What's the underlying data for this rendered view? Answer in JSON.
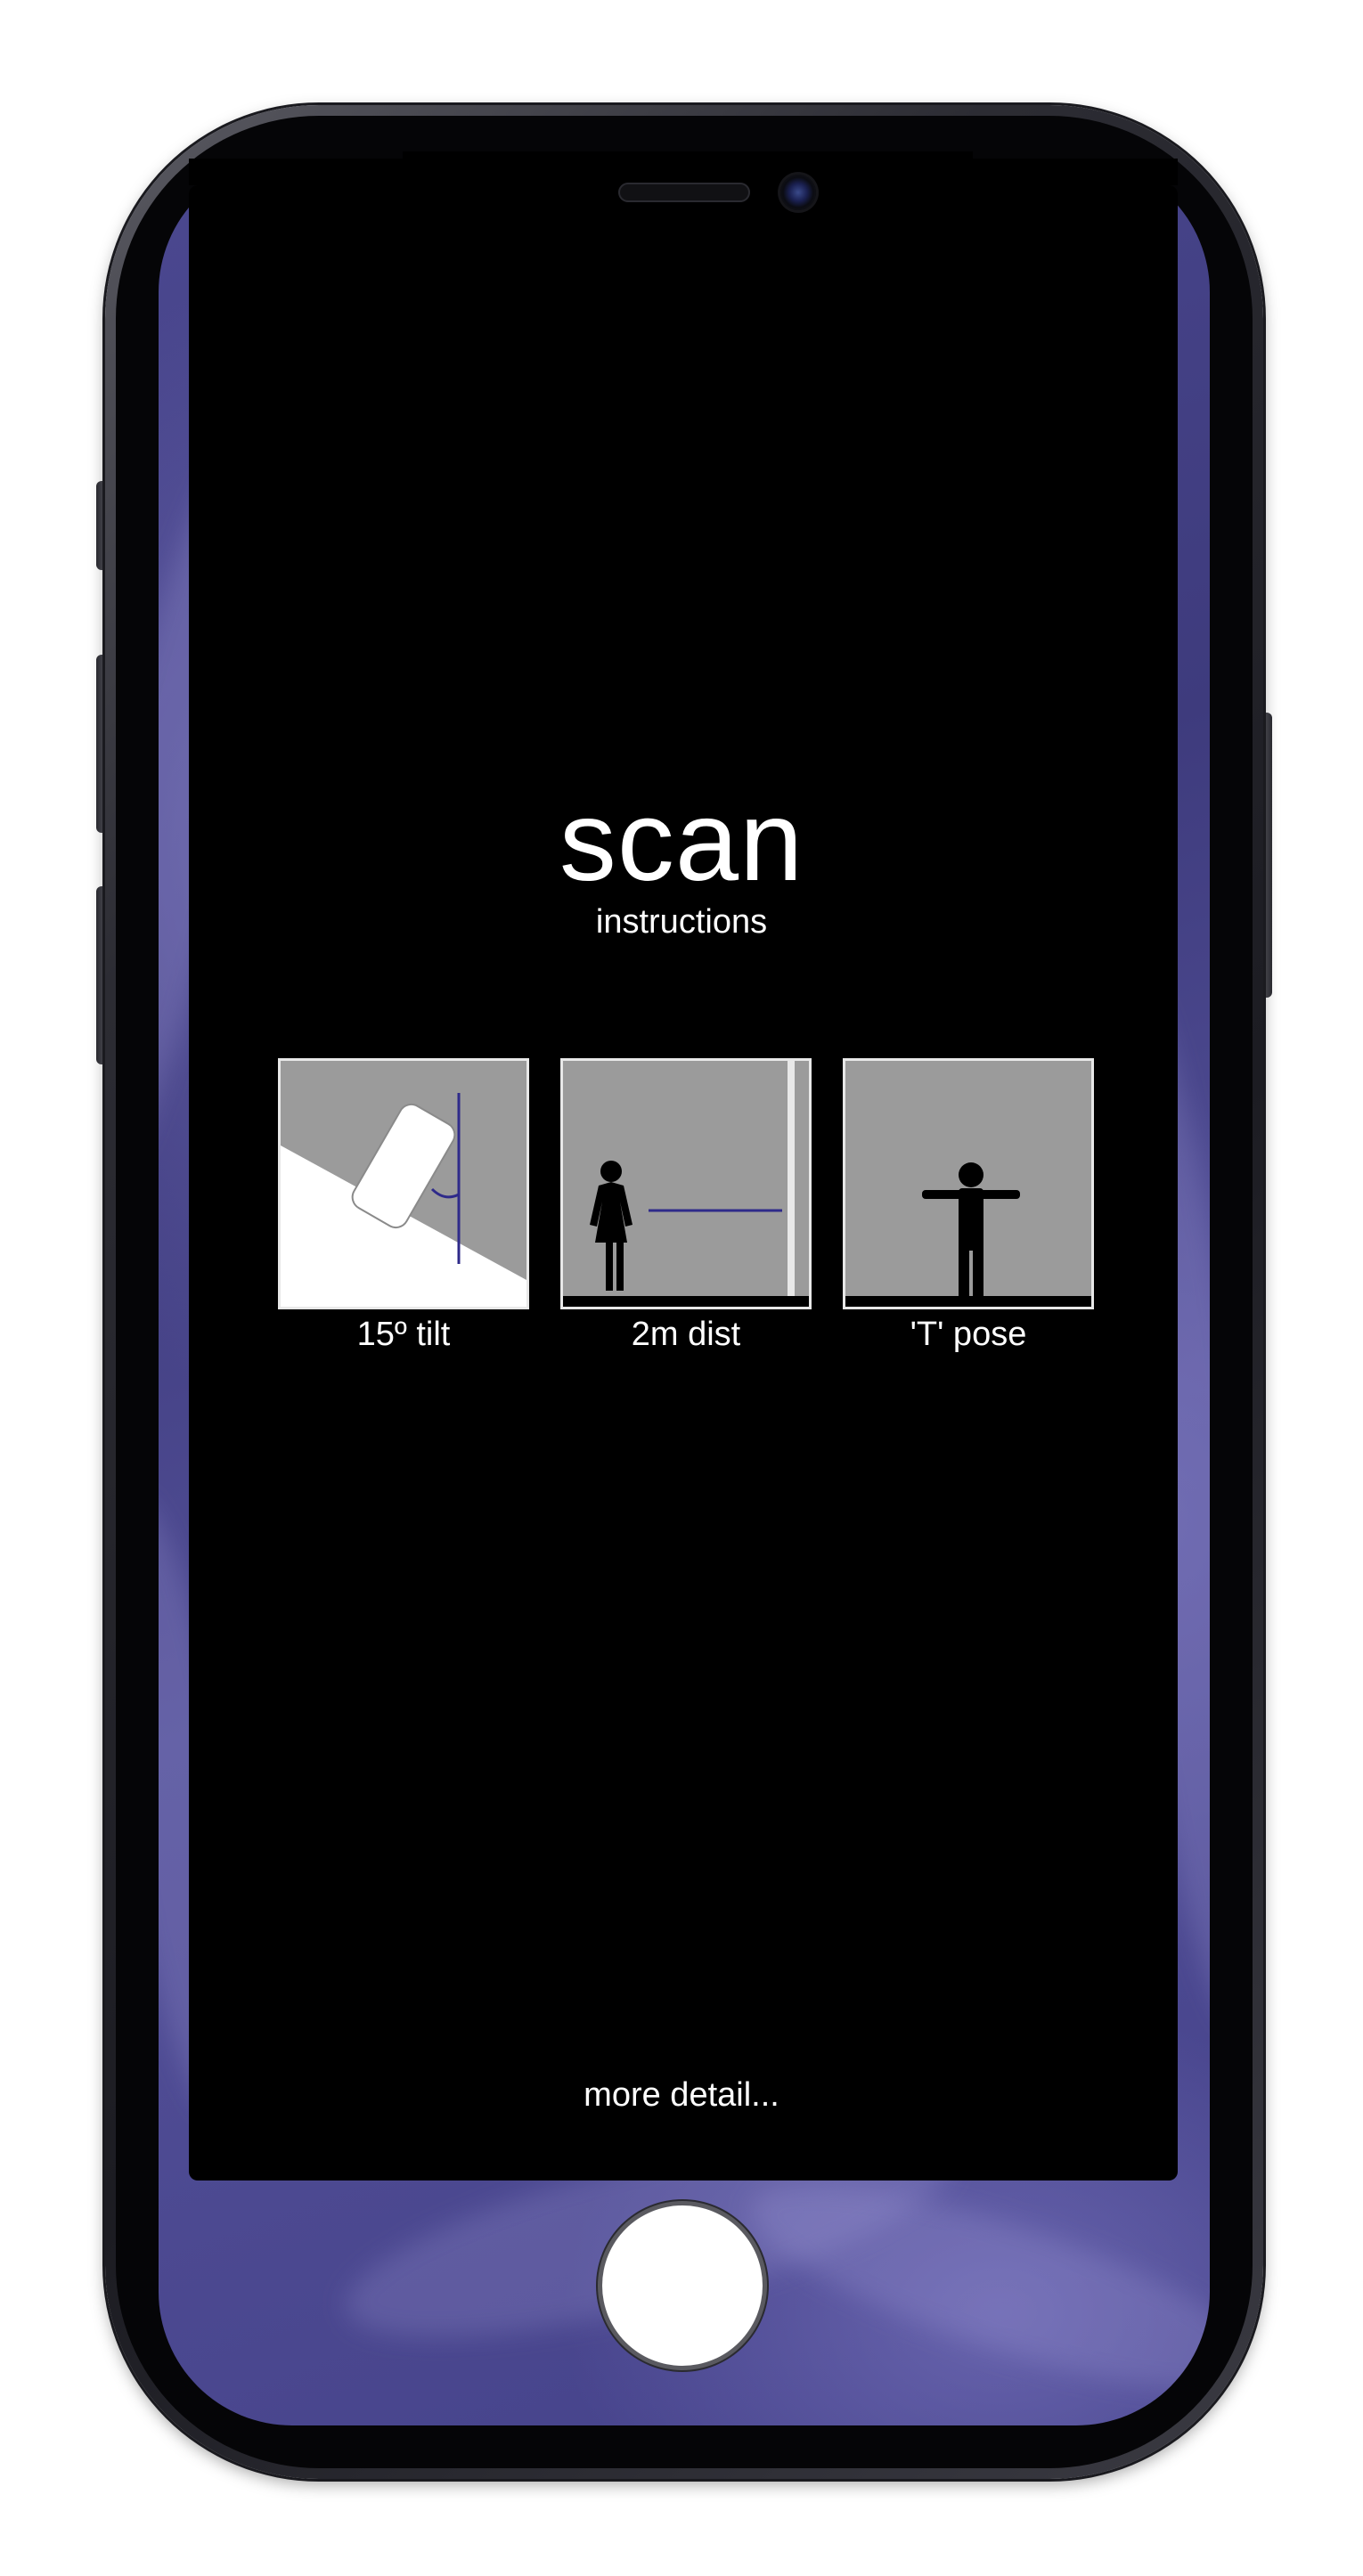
{
  "app": {
    "title": "scan",
    "subtitle": "instructions"
  },
  "instructions": [
    {
      "label": "15º tilt",
      "icon": "phone-tilt-icon"
    },
    {
      "label": "2m dist",
      "icon": "person-distance-icon"
    },
    {
      "label": "'T' pose",
      "icon": "t-pose-icon"
    }
  ],
  "footer": {
    "more_detail": "more detail..."
  },
  "colors": {
    "screen_background": "#000000",
    "tile_background": "#9b9b9b",
    "accent_line": "#2e2a8a",
    "wallpaper": "#4b4890"
  }
}
